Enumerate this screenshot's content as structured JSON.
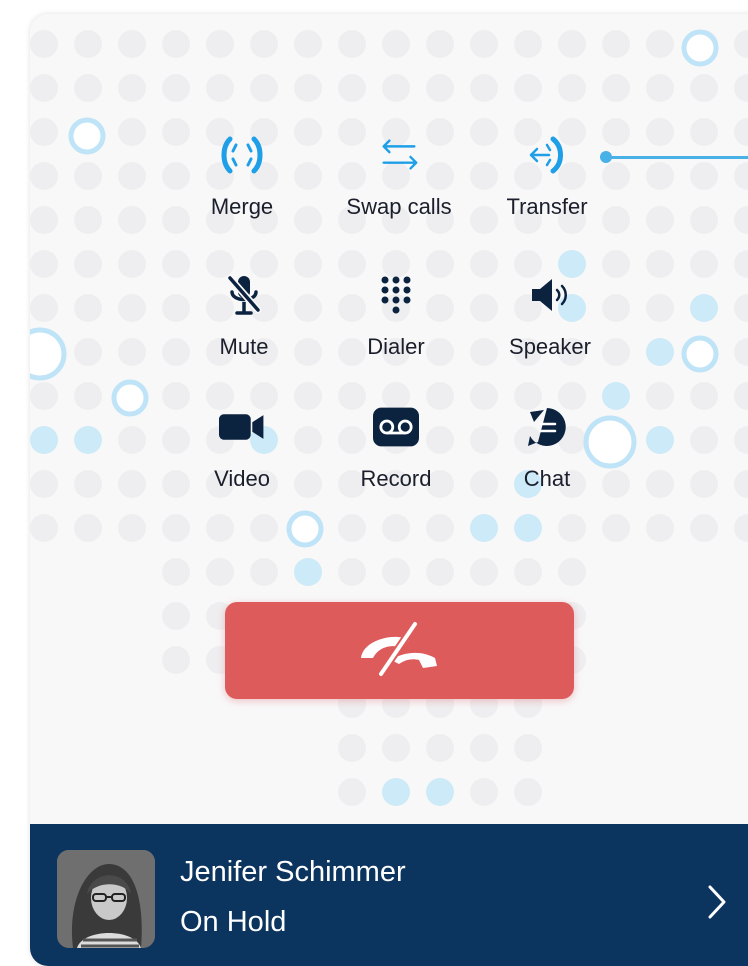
{
  "actions": [
    {
      "id": "merge",
      "label": "Merge",
      "icon": "merge-icon"
    },
    {
      "id": "swap",
      "label": "Swap calls",
      "icon": "swap-calls-icon"
    },
    {
      "id": "transfer",
      "label": "Transfer",
      "icon": "transfer-icon"
    },
    {
      "id": "mute",
      "label": "Mute",
      "icon": "microphone-muted-icon"
    },
    {
      "id": "dialer",
      "label": "Dialer",
      "icon": "dialpad-icon"
    },
    {
      "id": "speaker",
      "label": "Speaker",
      "icon": "speaker-icon"
    },
    {
      "id": "video",
      "label": "Video",
      "icon": "video-camera-icon"
    },
    {
      "id": "record",
      "label": "Record",
      "icon": "voicemail-record-icon"
    },
    {
      "id": "chat",
      "label": "Chat",
      "icon": "chat-bubble-icon"
    }
  ],
  "end_call": {
    "icon": "hang-up-phone-icon"
  },
  "caller": {
    "name": "Jenifer Schimmer",
    "status": "On Hold",
    "chevron_icon": "chevron-right-icon"
  },
  "colors": {
    "accent": "#1e9fe8",
    "end_call": "#de5b5c",
    "caller_bar": "#0b345f",
    "icon_dark": "#0c2340",
    "dot_light": "#eeeef0",
    "dot_blue": "#cdeaf8"
  }
}
